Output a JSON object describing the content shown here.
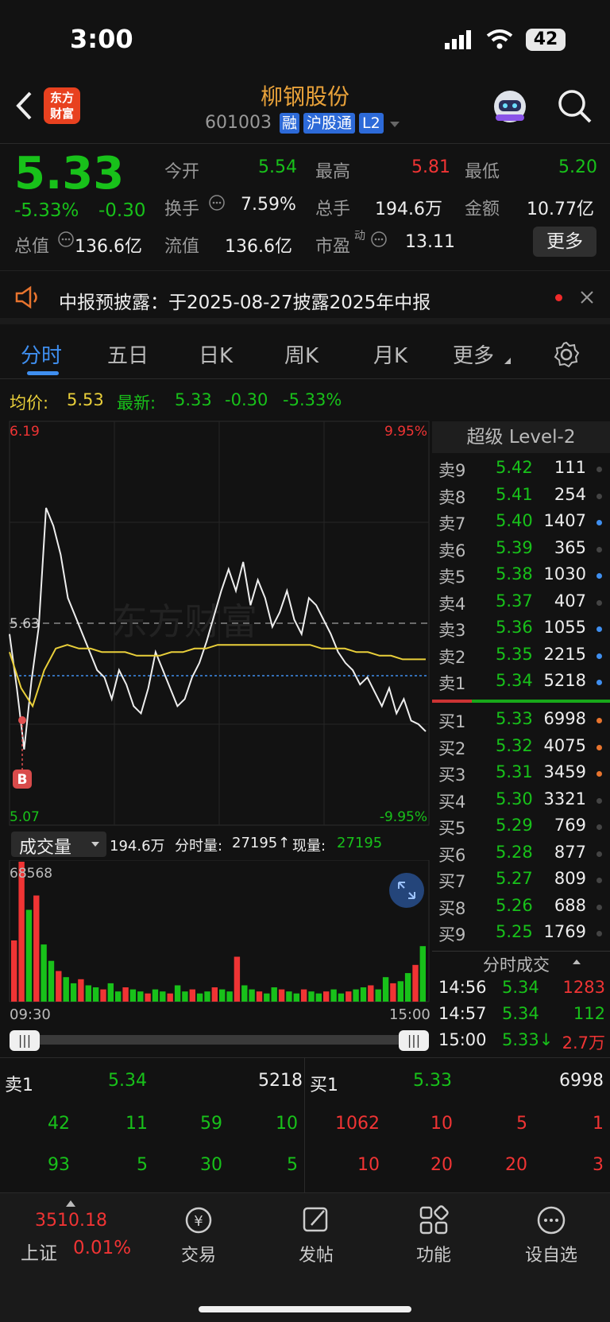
{
  "status": {
    "time": "3:00",
    "battery": "42"
  },
  "header": {
    "stock_name": "柳钢股份",
    "code": "601003",
    "badge_rong": "融",
    "badge_hgt": "沪股通",
    "badge_l2": "L2",
    "logo_text_top": "东方",
    "logo_text_bottom": "财富"
  },
  "quote": {
    "price": "5.33",
    "change_pct": "-5.33%",
    "change": "-0.30",
    "open_label": "今开",
    "open": "5.54",
    "high_label": "最高",
    "high": "5.81",
    "low_label": "最低",
    "low": "5.20",
    "turnover_label": "换手",
    "turnover": "7.59%",
    "volume_label": "总手",
    "volume": "194.6万",
    "amount_label": "金额",
    "amount": "10.77亿",
    "mcap_label": "总值",
    "mcap": "136.6亿",
    "float_label": "流值",
    "float": "136.6亿",
    "pe_label": "市盈",
    "pe_sup": "动",
    "pe": "13.11",
    "more": "更多"
  },
  "notice": {
    "text": "中报预披露：于2025-08-27披露2025年中报"
  },
  "tabs": [
    "分时",
    "五日",
    "日K",
    "周K",
    "月K",
    "更多"
  ],
  "chart_header": {
    "avg_label": "均价:",
    "avg": "5.53",
    "latest_label": "最新:",
    "latest": "5.33",
    "latest_change": "-0.30",
    "latest_pct": "-5.33%"
  },
  "chart_labels": {
    "y_top": "6.19",
    "y_top_pct": "9.95%",
    "y_mid": "5.63",
    "y_bottom": "5.07",
    "y_bottom_pct": "-9.95%",
    "marker": "B",
    "vol_selector": "成交量",
    "vol_total": "194.6万",
    "vol_fenshi_label": "分时量:",
    "vol_fenshi": "27195",
    "vol_now_label": "现量:",
    "vol_now": "27195",
    "vol_max": "68568",
    "time_start": "09:30",
    "time_end": "15:00"
  },
  "chart_data": [
    {
      "type": "line",
      "title": "",
      "x_range": [
        "09:30",
        "15:00"
      ],
      "ylim": [
        5.07,
        6.19
      ],
      "reference": 5.63,
      "series": [
        {
          "name": "",
          "values": [
            5.6,
            5.45,
            5.28,
            5.47,
            5.62,
            5.95,
            5.9,
            5.82,
            5.7,
            5.65,
            5.6,
            5.55,
            5.5,
            5.48,
            5.42,
            5.5,
            5.46,
            5.4,
            5.38,
            5.45,
            5.55,
            5.5,
            5.45,
            5.4,
            5.42,
            5.48,
            5.52,
            5.58,
            5.65,
            5.72,
            5.78,
            5.72,
            5.8,
            5.68,
            5.75,
            5.7,
            5.62,
            5.66,
            5.72,
            5.64,
            5.6,
            5.7,
            5.68,
            5.64,
            5.6,
            5.55,
            5.52,
            5.5,
            5.46,
            5.48,
            5.44,
            5.4,
            5.45,
            5.38,
            5.42,
            5.36,
            5.35,
            5.33
          ]
        },
        {
          "name": "均价",
          "values": [
            5.55,
            5.45,
            5.4,
            5.5,
            5.56,
            5.57,
            5.56,
            5.56,
            5.55,
            5.55,
            5.55,
            5.54,
            5.54,
            5.54,
            5.55,
            5.55,
            5.56,
            5.56,
            5.57,
            5.57,
            5.57,
            5.57,
            5.57,
            5.57,
            5.57,
            5.57,
            5.57,
            5.56,
            5.56,
            5.56,
            5.55,
            5.55,
            5.54,
            5.54,
            5.53,
            5.53,
            5.53
          ]
        }
      ]
    },
    {
      "type": "bar",
      "title": "",
      "ylim": [
        0,
        68568
      ],
      "series": [
        {
          "name": "成交量",
          "values": [
            30000,
            68568,
            45000,
            52000,
            28000,
            20000,
            15000,
            12000,
            9000,
            11000,
            8000,
            7000,
            6000,
            9000,
            5000,
            7000,
            6000,
            5000,
            4000,
            6000,
            5000,
            4000,
            8000,
            5000,
            6000,
            4000,
            5000,
            7000,
            6000,
            5000,
            22000,
            8000,
            6000,
            5000,
            4000,
            7000,
            6000,
            5000,
            4000,
            6000,
            5000,
            4000,
            5000,
            6000,
            4000,
            5000,
            6000,
            7000,
            8000,
            6000,
            12000,
            9000,
            10000,
            14000,
            18000,
            27195
          ]
        }
      ]
    }
  ],
  "level2": {
    "title": "超级 Level-2",
    "asks": [
      {
        "label": "卖9",
        "price": "5.42",
        "vol": "111"
      },
      {
        "label": "卖8",
        "price": "5.41",
        "vol": "254"
      },
      {
        "label": "卖7",
        "price": "5.40",
        "vol": "1407"
      },
      {
        "label": "卖6",
        "price": "5.39",
        "vol": "365"
      },
      {
        "label": "卖5",
        "price": "5.38",
        "vol": "1030"
      },
      {
        "label": "卖4",
        "price": "5.37",
        "vol": "407"
      },
      {
        "label": "卖3",
        "price": "5.36",
        "vol": "1055"
      },
      {
        "label": "卖2",
        "price": "5.35",
        "vol": "2215"
      },
      {
        "label": "卖1",
        "price": "5.34",
        "vol": "5218"
      }
    ],
    "bids": [
      {
        "label": "买1",
        "price": "5.33",
        "vol": "6998"
      },
      {
        "label": "买2",
        "price": "5.32",
        "vol": "4075"
      },
      {
        "label": "买3",
        "price": "5.31",
        "vol": "3459"
      },
      {
        "label": "买4",
        "price": "5.30",
        "vol": "3321"
      },
      {
        "label": "买5",
        "price": "5.29",
        "vol": "769"
      },
      {
        "label": "买6",
        "price": "5.28",
        "vol": "877"
      },
      {
        "label": "买7",
        "price": "5.27",
        "vol": "809"
      },
      {
        "label": "买8",
        "price": "5.26",
        "vol": "688"
      },
      {
        "label": "买9",
        "price": "5.25",
        "vol": "1769"
      }
    ],
    "ticks_title": "分时成交",
    "ticks": [
      {
        "time": "14:56",
        "price": "5.34",
        "vol": "1283"
      },
      {
        "time": "14:57",
        "price": "5.34",
        "vol": "112"
      },
      {
        "time": "15:00",
        "price": "5.33↓",
        "vol": "2.7万"
      }
    ]
  },
  "queue": {
    "sell_label": "卖1",
    "sell_price": "5.34",
    "sell_vol": "5218",
    "buy_label": "买1",
    "buy_price": "5.33",
    "buy_vol": "6998",
    "sell_rows": [
      [
        "42",
        "11",
        "59",
        "10"
      ],
      [
        "93",
        "5",
        "30",
        "5"
      ]
    ],
    "buy_rows": [
      [
        "1062",
        "10",
        "5",
        "1"
      ],
      [
        "10",
        "20",
        "20",
        "3"
      ]
    ]
  },
  "nav": {
    "index_value": "3510.18",
    "index_name": "上证",
    "index_pct": "0.01%",
    "items": [
      "交易",
      "发帖",
      "功能",
      "设自选"
    ]
  },
  "colors": {
    "up": "#f03434",
    "down": "#18c11a",
    "avg_line": "#e9cf3a",
    "accent": "#3f8ff0"
  }
}
